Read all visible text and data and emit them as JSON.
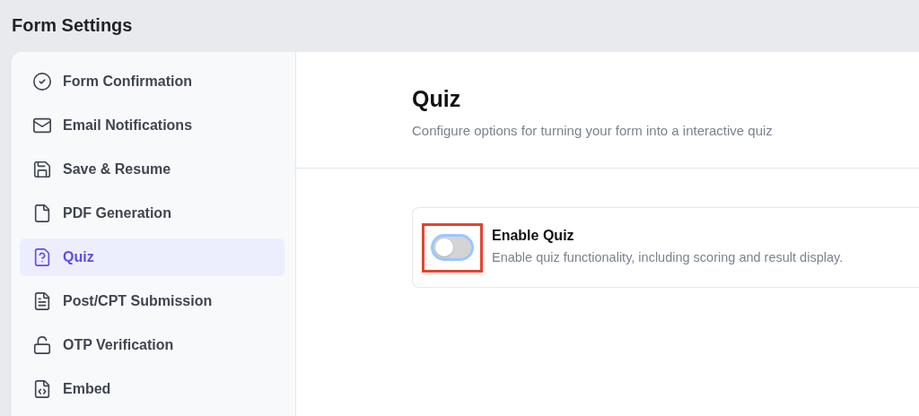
{
  "page_title": "Form Settings",
  "sidebar": {
    "items": [
      {
        "label": "Form Confirmation",
        "selected": false
      },
      {
        "label": "Email Notifications",
        "selected": false
      },
      {
        "label": "Save & Resume",
        "selected": false
      },
      {
        "label": "PDF Generation",
        "selected": false
      },
      {
        "label": "Quiz",
        "selected": true
      },
      {
        "label": "Post/CPT Submission",
        "selected": false
      },
      {
        "label": "OTP Verification",
        "selected": false
      },
      {
        "label": "Embed",
        "selected": false
      }
    ]
  },
  "section": {
    "title": "Quiz",
    "subtitle": "Configure options for turning your form into a interactive quiz"
  },
  "settings": [
    {
      "label": "Enable Quiz",
      "description": "Enable quiz functionality, including scoring and result display.",
      "on": false,
      "highlighted": true
    }
  ]
}
